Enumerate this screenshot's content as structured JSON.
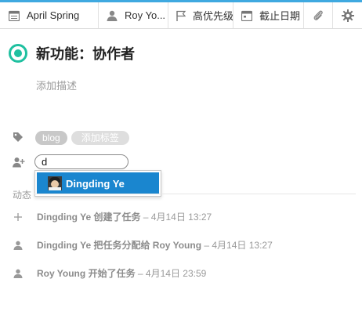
{
  "toolbar": {
    "project": "April Spring",
    "owner": "Roy Yo...",
    "priority": "高优先级",
    "due_date": "截止日期",
    "icons": {
      "project": "calendar-list-icon",
      "owner": "person-icon",
      "priority": "flag-icon",
      "due_date": "calendar-icon",
      "attach": "paperclip-icon",
      "settings": "gear-icon"
    }
  },
  "task": {
    "title": "新功能：协作者",
    "description_placeholder": "添加描述",
    "status_color": "#1fc0a0"
  },
  "tags": {
    "items": [
      "blog"
    ],
    "add_label": "添加标签"
  },
  "assign": {
    "input_value": "d",
    "suggestions": [
      {
        "first": "D",
        "rest": "ingding Ye"
      }
    ]
  },
  "activity": {
    "label": "动态",
    "items": [
      {
        "actor": "Dingding Ye",
        "action": " 创建了任务",
        "time": " – 4月14日 13:27"
      },
      {
        "actor": "Dingding Ye",
        "action": " 把任务分配给 ",
        "target": "Roy Young",
        "time": " – 4月14日 13:27"
      },
      {
        "actor": "Roy Young",
        "action": " 开始了任务",
        "time": " – 4月14日 23:59"
      }
    ]
  },
  "colors": {
    "accent": "#3fa9e0",
    "selection": "#1a86cf",
    "muted_text": "#9a9a9a"
  }
}
